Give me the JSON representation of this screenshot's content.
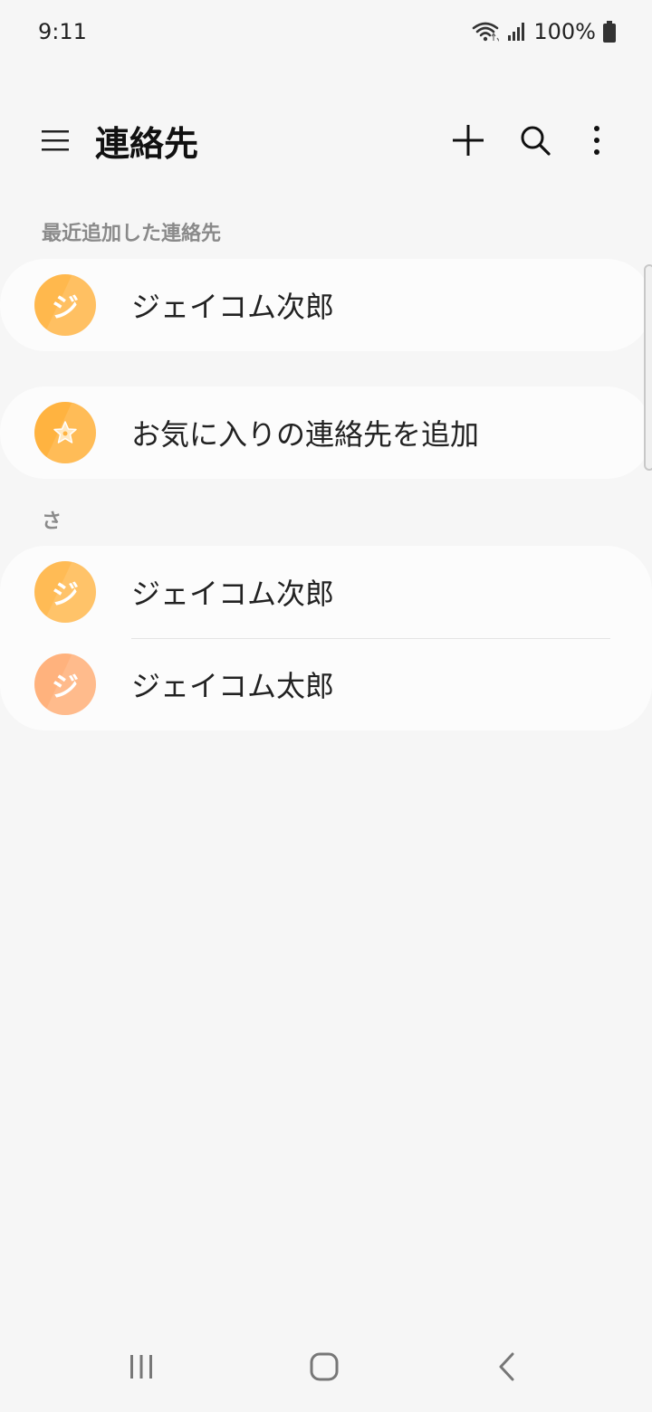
{
  "status": {
    "time": "9:11",
    "battery": "100%"
  },
  "appbar": {
    "title": "連絡先"
  },
  "sections": {
    "recent": {
      "header": "最近追加した連絡先"
    },
    "sa": {
      "header": "さ"
    }
  },
  "recent_contact": {
    "initial": "ジ",
    "name": "ジェイコム次郎",
    "color": "#ffb84d"
  },
  "favorites": {
    "label": "お気に入りの連絡先を追加",
    "color": "#ffb340"
  },
  "contacts": [
    {
      "initial": "ジ",
      "name": "ジェイコム次郎",
      "color": "#ffbb55"
    },
    {
      "initial": "ジ",
      "name": "ジェイコム太郎",
      "color": "#ffb27d"
    }
  ],
  "icons": {
    "menu": "menu-icon",
    "add": "plus-icon",
    "search": "search-icon",
    "more": "more-vertical-icon",
    "favorite": "star-icon",
    "wifi": "wifi-icon",
    "signal": "signal-icon",
    "battery": "battery-icon",
    "recents": "recents-icon",
    "home": "home-icon",
    "back": "back-icon"
  }
}
